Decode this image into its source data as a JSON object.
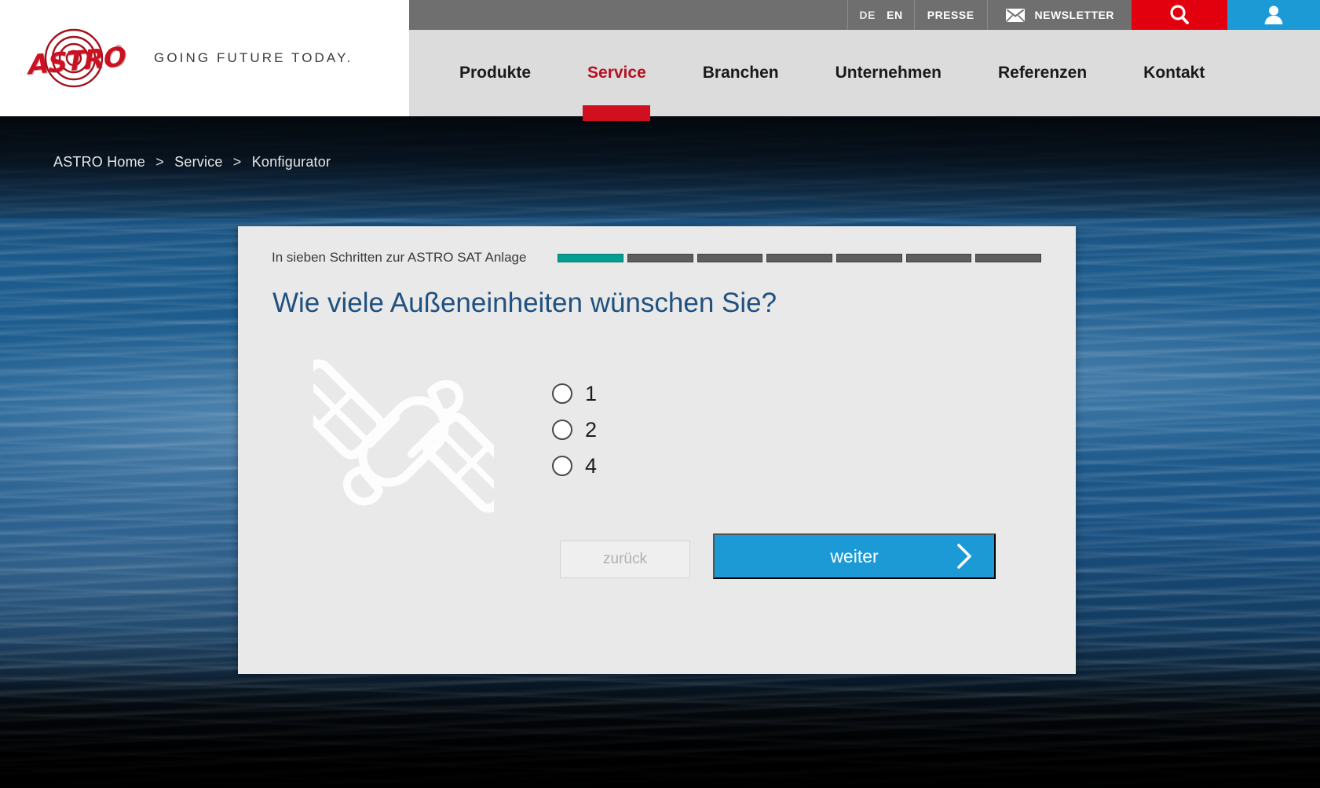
{
  "brand": {
    "logo_word": "ASTRO",
    "logo_registered": "®",
    "tagline": "GOING FUTURE TODAY."
  },
  "topbar": {
    "lang_de": "DE",
    "lang_en": "EN",
    "presse": "PRESSE",
    "newsletter": "NEWSLETTER",
    "search_icon": "search-icon",
    "user_icon": "user-icon",
    "mail_icon": "mail-icon",
    "search_bg": "#e2000f",
    "user_bg": "#1b9ad6",
    "bar_bg": "#6f6f6f"
  },
  "nav": {
    "items": [
      {
        "label": "Produkte",
        "active": false
      },
      {
        "label": "Service",
        "active": true
      },
      {
        "label": "Branchen",
        "active": false
      },
      {
        "label": "Unternehmen",
        "active": false
      },
      {
        "label": "Referenzen",
        "active": false
      },
      {
        "label": "Kontakt",
        "active": false
      }
    ],
    "active_color": "#b5111f",
    "indicator_color": "#d1101f"
  },
  "breadcrumb": {
    "home": "ASTRO Home",
    "sep1": ">",
    "service": "Service",
    "sep2": ">",
    "current": "Konfigurator"
  },
  "configurator": {
    "step_label": "In sieben Schritten zur ASTRO SAT Anlage",
    "steps_total": 7,
    "steps_done": 1,
    "step_done_color": "#039e91",
    "step_todo_color": "#5e5e5e",
    "question": "Wie viele Außeneinheiten wünschen Sie?",
    "question_color": "#20517f",
    "illustration_icon": "satellite-icon",
    "options": [
      {
        "label": "1",
        "selected": false
      },
      {
        "label": "2",
        "selected": false
      },
      {
        "label": "4",
        "selected": false
      }
    ],
    "back_label": "zurück",
    "next_label": "weiter",
    "next_icon": "chevron-right-icon",
    "next_color": "#1b9ad6",
    "back_disabled": true
  }
}
